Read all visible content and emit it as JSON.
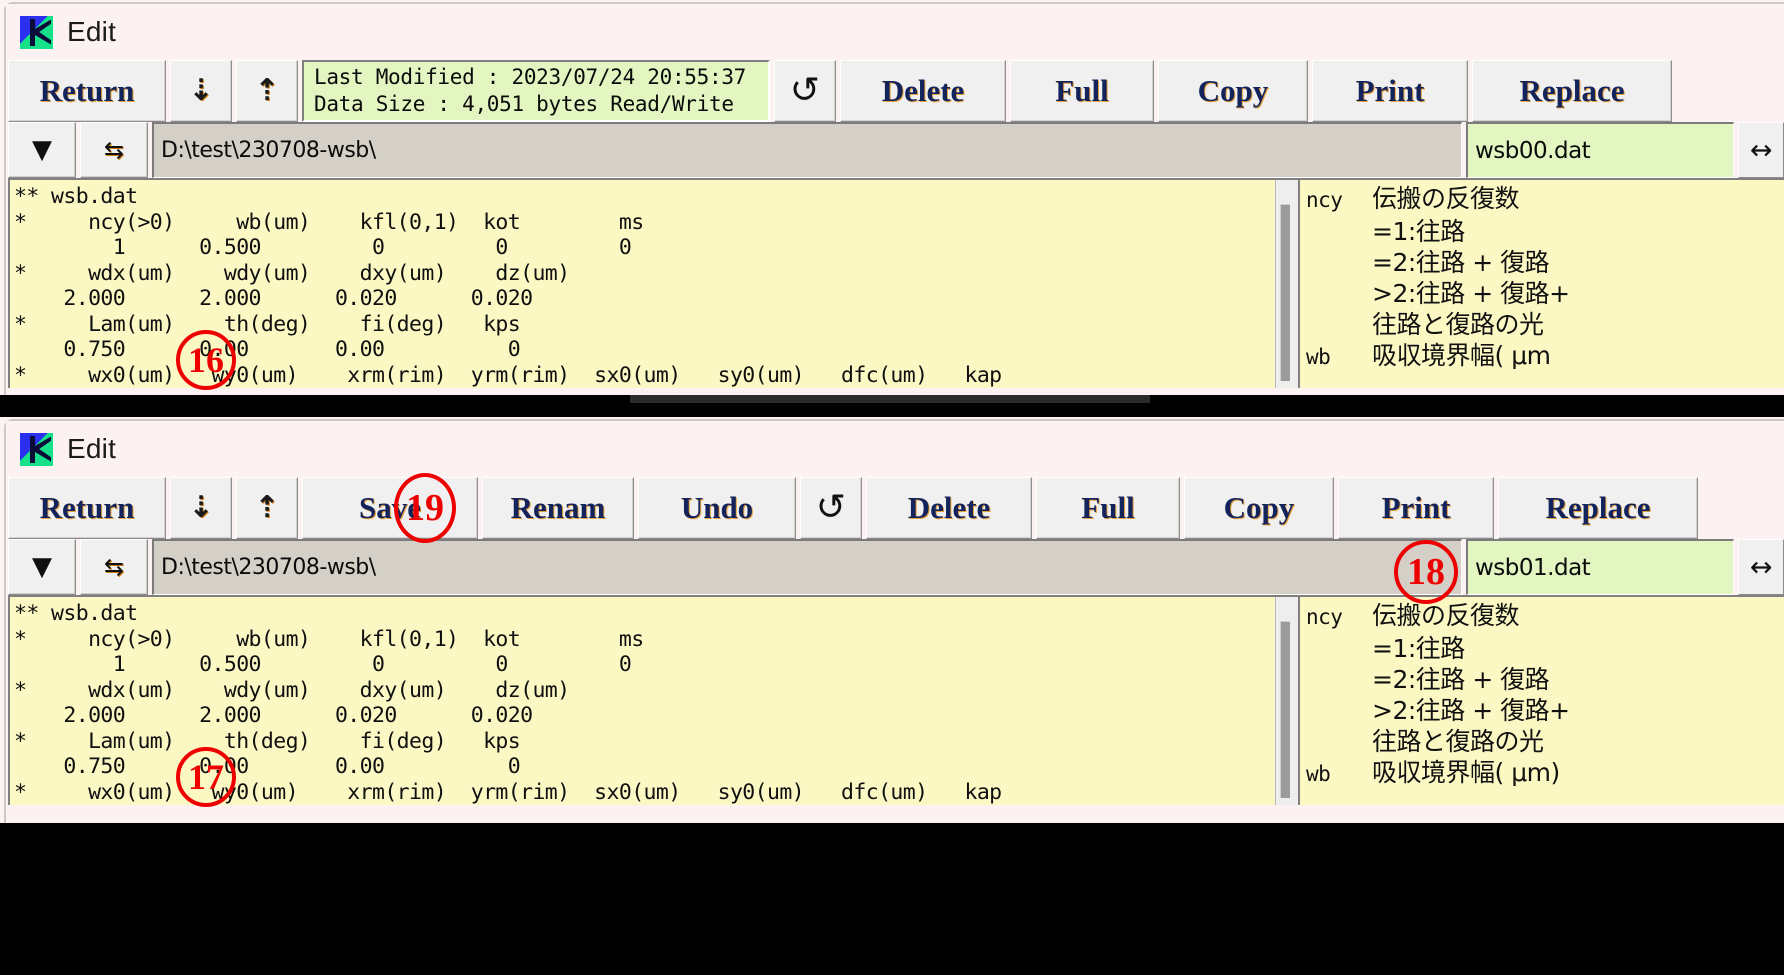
{
  "window_title": "Edit",
  "app_icon": "k-logo-icon",
  "panels": [
    {
      "id": "top",
      "toolbar": {
        "return_label": "Return",
        "down_icon": "arrow-down-dotted-icon",
        "up_icon": "arrow-up-dotted-icon",
        "reload_icon": "reload-icon",
        "delete_label": "Delete",
        "full_label": "Full",
        "copy_label": "Copy",
        "print_label": "Print",
        "replace_label": "Replace"
      },
      "info": {
        "line1": "Last Modified : 2023/07/24 20:55:37",
        "line2": "Data Size : 4,051 bytes  Read/Write"
      },
      "path_row": {
        "dropdown_icon": "chevron-down-icon",
        "swap_icon": "swap-arrows-icon",
        "path_value": "D:\\test\\230708-wsb\\",
        "file_value": "wsb00.dat",
        "resize_icon": "horizontal-resize-icon"
      },
      "editor_text": "** wsb.dat\n*     ncy(>0)     wb(um)    kfl(0,1)  kot        ms\n        1      0.500         0         0         0\n*     wdx(um)    wdy(um)    dxy(um)    dz(um)\n    2.000      2.000      0.020      0.020\n*     Lam(um)    th(deg)    fi(deg)   kps\n    0.750      0.00       0.00          0\n*     wx0(um)   wy0(um)    xrm(rim)  yrm(rim)  sx0(um)   sy0(um)   dfc(um)   kap",
      "help": {
        "key": "ncy",
        "lines": [
          "伝搬の反復数",
          "=1:往路",
          "=2:往路 + 復路",
          ">2:往路 + 復路+",
          "往路と復路の光"
        ],
        "key2": "wb",
        "line2": "吸収境界幅( μm"
      }
    },
    {
      "id": "bottom",
      "toolbar": {
        "return_label": "Return",
        "down_icon": "arrow-down-dotted-icon",
        "up_icon": "arrow-up-dotted-icon",
        "save_label": "Save",
        "renam_label": "Renam",
        "undo_label": "Undo",
        "reload_icon": "reload-icon",
        "delete_label": "Delete",
        "full_label": "Full",
        "copy_label": "Copy",
        "print_label": "Print",
        "replace_label": "Replace"
      },
      "path_row": {
        "dropdown_icon": "chevron-down-icon",
        "swap_icon": "swap-arrows-icon",
        "path_value": "D:\\test\\230708-wsb\\",
        "file_value": "wsb01.dat",
        "resize_icon": "horizontal-resize-icon"
      },
      "editor_text": "** wsb.dat\n*     ncy(>0)     wb(um)    kfl(0,1)  kot        ms\n        1      0.500         0         0         0\n*     wdx(um)    wdy(um)    dxy(um)    dz(um)\n    2.000      2.000      0.020      0.020\n*     Lam(um)    th(deg)    fi(deg)   kps\n    0.750      0.00       0.00          0\n*     wx0(um)   wy0(um)    xrm(rim)  yrm(rim)  sx0(um)   sy0(um)   dfc(um)   kap",
      "help": {
        "key": "ncy",
        "lines": [
          "伝搬の反復数",
          "=1:往路",
          "=2:往路 + 復路",
          ">2:往路 + 復路+",
          "往路と復路の光"
        ],
        "key2": "wb",
        "line2": "吸収境界幅( μm)"
      }
    }
  ],
  "annotations": [
    {
      "id": "16",
      "label": "16"
    },
    {
      "id": "17",
      "label": "17"
    },
    {
      "id": "18",
      "label": "18"
    },
    {
      "id": "19",
      "label": "19"
    }
  ],
  "colors": {
    "info_green": "#e3f5c0",
    "editor_yellow": "#fbf8c4",
    "button_face": "#f0f0f0",
    "annotation_red": "#ee0000",
    "title_pink": "#fdf2f2"
  }
}
